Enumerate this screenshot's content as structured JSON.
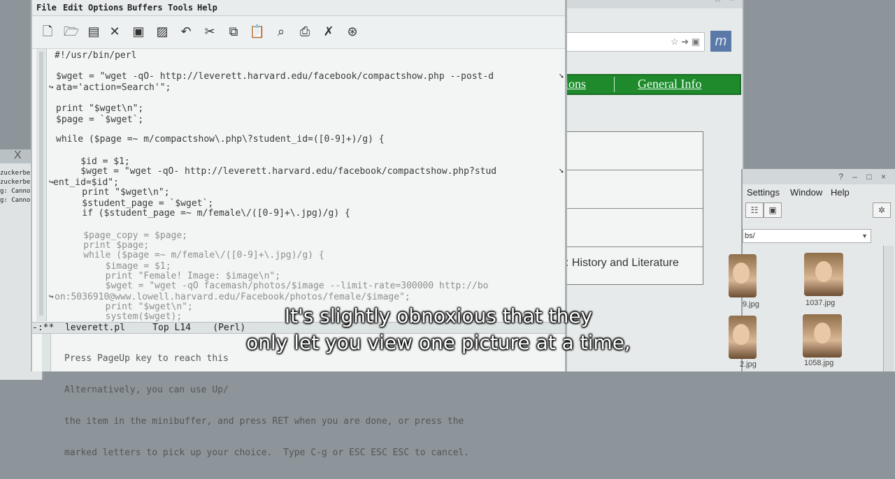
{
  "left_terminal": {
    "close_glyph": "X",
    "lines": [
      "zuckerber",
      "zuckerber",
      "g: Cannot",
      "g: Cannot"
    ]
  },
  "browser": {
    "window_controls": "– □ ×",
    "logo_icon": "facebook-logo-icon",
    "nav_partial": "ions",
    "nav_general_info": "General Info",
    "section_label": ": History and Literature"
  },
  "file_browser": {
    "window_controls": "? – □ ×",
    "menu": [
      "Settings",
      "Window",
      "Help"
    ],
    "path": "bs/",
    "thumbnails": [
      {
        "label": "9.jpg"
      },
      {
        "label": "1037.jpg"
      },
      {
        "label": "2.jpg"
      },
      {
        "label": "1058.jpg"
      }
    ]
  },
  "emacs": {
    "menu": [
      "File",
      "Edit",
      "Options",
      "Buffers",
      "Tools",
      "Help"
    ],
    "toolbar_icons": [
      "new-file-icon",
      "open-folder-icon",
      "dired-icon",
      "close-icon",
      "save-icon",
      "save-as-icon",
      "undo-icon",
      "cut-icon",
      "copy-icon",
      "paste-icon",
      "search-icon",
      "print-icon",
      "preferences-icon",
      "help-icon"
    ],
    "code": [
      "#!/usr/bin/perl",
      "$wget = \"wget -qO- http://leverett.harvard.edu/facebook/compactshow.php --post-d",
      "ata='action=Search'\";",
      "print \"$wget\\n\";",
      "$page = `$wget`;",
      "while ($page =~ m/compactshow\\.php\\?student_id=([0-9]+)/g) {",
      "    $id = $1;",
      "    $wget = \"wget -qO- http://leverett.harvard.edu/facebook/compactshow.php?stud",
      "ent_id=$id\";",
      "    print \"$wget\\n\";",
      "    $student_page = `$wget`;",
      "    if ($student_page =~ m/female\\/([0-9]+\\.jpg)/g) {",
      "    $page_copy = $page;",
      "    print $page;",
      "    while ($page =~ m/female\\/([0-9]+\\.jpg)/g) {",
      "        $image = $1;",
      "        print \"Female! Image: $image\\n\";",
      "        $wget = \"wget -qO facemash/photos/$image --limit-rate=300000 http://bo",
      "on:5036910@www.lowell.harvard.edu/Facebook/photos/female/$image\";",
      "        print \"$wget\\n\";",
      "        system($wget);"
    ],
    "modeline": "-:**  leverett.pl     Top L14    (Perl)",
    "minibuffer": [
      "Press PageUp key to reach this",
      "Alternatively, you can use Up/",
      "the item in the minibuffer, and press RET when you are done, or press the",
      "marked letters to pick up your choice.  Type C-g or ESC ESC ESC to cancel."
    ]
  },
  "subtitle": {
    "line1": "It's slightly obnoxious that they",
    "line2": "only let you view one picture at a time,"
  }
}
